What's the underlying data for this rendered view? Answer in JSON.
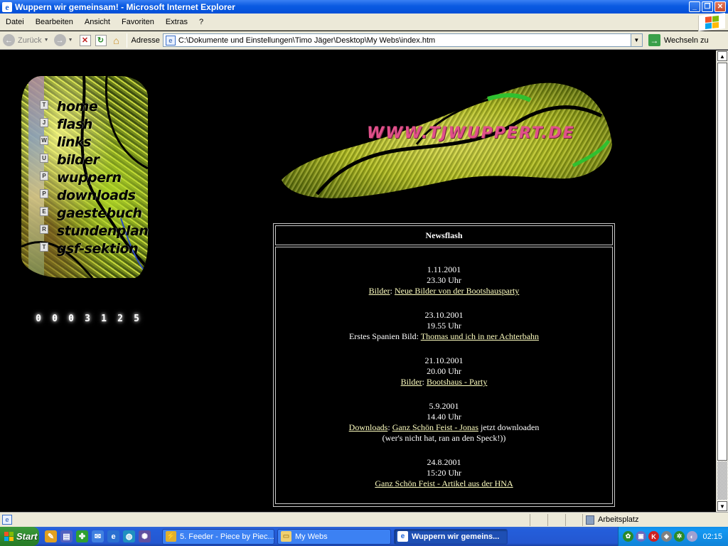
{
  "window": {
    "title": "Wuppern wir gemeinsam! - Microsoft Internet Explorer",
    "icon": "ie-icon"
  },
  "menu": {
    "items": [
      "Datei",
      "Bearbeiten",
      "Ansicht",
      "Favoriten",
      "Extras",
      "?"
    ]
  },
  "toolbar": {
    "back_label": "Zurück",
    "address_label": "Adresse",
    "address_value": "C:\\Dokumente und Einstellungen\\Timo Jäger\\Desktop\\My Webs\\index.htm",
    "go_label": "Wechseln zu"
  },
  "page": {
    "side_letters": [
      "T",
      "J",
      "W",
      "U",
      "P",
      "P",
      "E",
      "R",
      "T"
    ],
    "nav_links": [
      "home",
      "flash",
      "links",
      "bilder",
      "wuppern",
      "downloads",
      "gaestebuch",
      "stundenplan",
      "gsf-sektion"
    ],
    "counter_digits": [
      "0",
      "0",
      "0",
      "3",
      "1",
      "2",
      "5"
    ],
    "banner_url": "WWW.TJWUPPERT.DE",
    "newsflash": {
      "title": "Newsflash",
      "entries": [
        {
          "date": "1.11.2001",
          "time": "23.30 Uhr",
          "category": "Bilder",
          "separator": ": ",
          "link": "Neue Bilder von der Bootshausparty"
        },
        {
          "date": "23.10.2001",
          "time": "19.55 Uhr",
          "prefix": "Erstes Spanien Bild: ",
          "link": "Thomas und ich in ner Achterbahn"
        },
        {
          "date": "21.10.2001",
          "time": "20.00 Uhr",
          "category": "Bilder",
          "separator": ": ",
          "link": "Bootshaus - Party"
        },
        {
          "date": "5.9.2001",
          "time": "14.40 Uhr",
          "category": "Downloads",
          "separator": ": ",
          "link": "Ganz Schön Feist - Jonas",
          "suffix": " jetzt downloaden",
          "note": "(wer's nicht hat, ran an den Speck!))"
        },
        {
          "date": "24.8.2001",
          "time": "15:20 Uhr",
          "link": "Ganz Schön Feist - Artikel aus der HNA"
        }
      ]
    }
  },
  "statusbar": {
    "zone_label": "Arbeitsplatz"
  },
  "taskbar": {
    "start_label": "Start",
    "tasks": [
      {
        "label": "5. Feeder - Piece by Piec...",
        "active": false
      },
      {
        "label": "My Webs",
        "active": false
      },
      {
        "label": "Wuppern wir gemeins...",
        "active": true
      }
    ],
    "clock": "02:15"
  },
  "colors": {
    "titlebar_blue": "#0a5ae2",
    "link_yellow": "#ffffc0",
    "banner_pink": "#e0508a",
    "page_background": "#000000"
  }
}
